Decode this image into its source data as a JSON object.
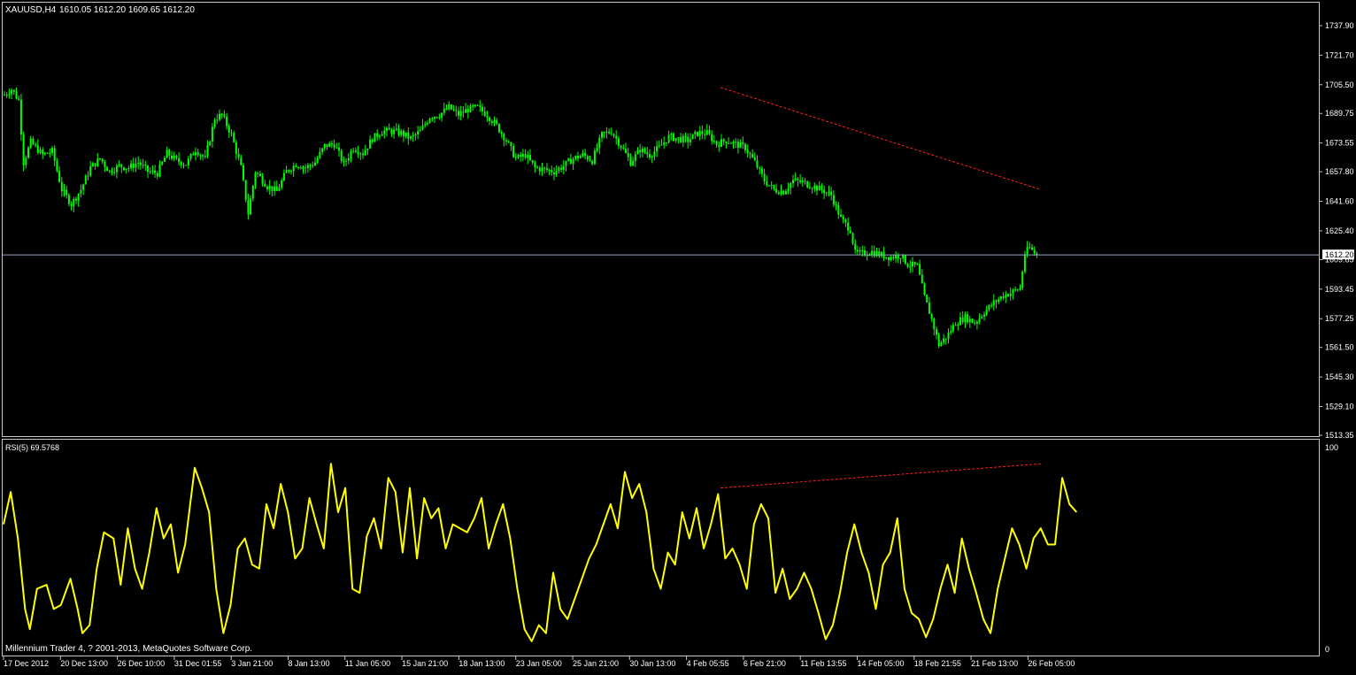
{
  "window": {
    "title": "XAUUSD,H4",
    "ohlc": "1610.05 1612.20 1609.65 1612.20"
  },
  "colors": {
    "background": "#000000",
    "frame": "#c8c8c8",
    "candle": "#00ff00",
    "rsi_line": "#ffff00",
    "trendline": "#ff2020",
    "current_price_line": "#9aa6c8"
  },
  "chart_data": [
    {
      "type": "candlestick",
      "title": "XAUUSD,H4",
      "symbol": "XAUUSD",
      "timeframe": "H4",
      "grid": false,
      "ylim": [
        1513.35,
        1750
      ],
      "y_ticks": [
        "1737.90",
        "1721.70",
        "1705.50",
        "1689.75",
        "1673.55",
        "1657.80",
        "1641.60",
        "1625.40",
        "1609.65",
        "1593.45",
        "1577.25",
        "1561.50",
        "1545.30",
        "1529.10",
        "1513.35"
      ],
      "current_price": "1612.20",
      "close_path": [
        [
          0,
          1700
        ],
        [
          3,
          1703
        ],
        [
          6,
          1697
        ],
        [
          8,
          1663
        ],
        [
          11,
          1674
        ],
        [
          16,
          1667
        ],
        [
          20,
          1669
        ],
        [
          24,
          1648
        ],
        [
          28,
          1640
        ],
        [
          32,
          1648
        ],
        [
          36,
          1660
        ],
        [
          40,
          1665
        ],
        [
          44,
          1658
        ],
        [
          48,
          1661
        ],
        [
          52,
          1660
        ],
        [
          56,
          1663
        ],
        [
          60,
          1658
        ],
        [
          64,
          1657
        ],
        [
          68,
          1668
        ],
        [
          72,
          1664
        ],
        [
          76,
          1662
        ],
        [
          80,
          1670
        ],
        [
          84,
          1665
        ],
        [
          88,
          1687
        ],
        [
          91,
          1689
        ],
        [
          95,
          1678
        ],
        [
          99,
          1660
        ],
        [
          102,
          1635
        ],
        [
          105,
          1658
        ],
        [
          110,
          1650
        ],
        [
          114,
          1647
        ],
        [
          118,
          1658
        ],
        [
          122,
          1662
        ],
        [
          126,
          1660
        ],
        [
          130,
          1663
        ],
        [
          134,
          1672
        ],
        [
          138,
          1673
        ],
        [
          142,
          1662
        ],
        [
          146,
          1671
        ],
        [
          150,
          1668
        ],
        [
          154,
          1676
        ],
        [
          158,
          1680
        ],
        [
          162,
          1680
        ],
        [
          166,
          1679
        ],
        [
          170,
          1676
        ],
        [
          174,
          1680
        ],
        [
          178,
          1688
        ],
        [
          182,
          1689
        ],
        [
          186,
          1693
        ],
        [
          190,
          1689
        ],
        [
          194,
          1692
        ],
        [
          198,
          1693
        ],
        [
          202,
          1689
        ],
        [
          206,
          1683
        ],
        [
          210,
          1675
        ],
        [
          214,
          1665
        ],
        [
          218,
          1667
        ],
        [
          222,
          1660
        ],
        [
          226,
          1659
        ],
        [
          230,
          1658
        ],
        [
          234,
          1661
        ],
        [
          238,
          1665
        ],
        [
          242,
          1667
        ],
        [
          246,
          1664
        ],
        [
          250,
          1678
        ],
        [
          254,
          1680
        ],
        [
          258,
          1672
        ],
        [
          262,
          1663
        ],
        [
          266,
          1670
        ],
        [
          270,
          1667
        ],
        [
          274,
          1671
        ],
        [
          278,
          1677
        ],
        [
          282,
          1676
        ],
        [
          286,
          1675
        ],
        [
          290,
          1679
        ],
        [
          294,
          1679
        ],
        [
          298,
          1673
        ],
        [
          302,
          1675
        ],
        [
          306,
          1673
        ],
        [
          310,
          1671
        ],
        [
          314,
          1663
        ],
        [
          318,
          1653
        ],
        [
          322,
          1648
        ],
        [
          326,
          1647
        ],
        [
          330,
          1653
        ],
        [
          334,
          1652
        ],
        [
          338,
          1650
        ],
        [
          342,
          1648
        ],
        [
          346,
          1645
        ],
        [
          350,
          1632
        ],
        [
          354,
          1626
        ],
        [
          356,
          1613
        ],
        [
          359,
          1613
        ],
        [
          363,
          1614
        ],
        [
          367,
          1612
        ],
        [
          371,
          1611
        ],
        [
          375,
          1612
        ],
        [
          378,
          1607
        ],
        [
          382,
          1606
        ],
        [
          385,
          1589
        ],
        [
          388,
          1577
        ],
        [
          391,
          1563
        ],
        [
          394,
          1567
        ],
        [
          398,
          1575
        ],
        [
          402,
          1578
        ],
        [
          406,
          1575
        ],
        [
          410,
          1581
        ],
        [
          414,
          1586
        ],
        [
          418,
          1590
        ],
        [
          422,
          1592
        ],
        [
          425,
          1594
        ],
        [
          427,
          1613
        ],
        [
          429,
          1616
        ],
        [
          432,
          1612
        ]
      ],
      "x_labels": [
        "17 Dec 2012",
        "20 Dec 13:00",
        "26 Dec 10:00",
        "31 Dec 01:55",
        "3 Jan 21:00",
        "8 Jan 13:00",
        "11 Jan 05:00",
        "15 Jan 21:00",
        "18 Jan 13:00",
        "23 Jan 05:00",
        "25 Jan 21:00",
        "30 Jan 13:00",
        "4 Feb 05:55",
        "6 Feb 21:00",
        "11 Feb 13:55",
        "14 Feb 05:00",
        "18 Feb 21:55",
        "21 Feb 13:00",
        "26 Feb 05:00"
      ],
      "annotations": [
        {
          "type": "trendline",
          "color": "#ff2020",
          "style": "dashed",
          "from": {
            "bar": 300,
            "price": 1704
          },
          "to": {
            "bar": 434,
            "price": 1648
          }
        }
      ]
    },
    {
      "type": "line",
      "title": "RSI(5) 69.5768",
      "series": [
        {
          "name": "RSI(5)",
          "value": "69.5768"
        }
      ],
      "ylim": [
        0,
        100
      ],
      "y_ticks": [
        "100",
        "0"
      ],
      "values": [
        [
          0,
          62
        ],
        [
          3,
          78
        ],
        [
          6,
          55
        ],
        [
          9,
          20
        ],
        [
          11,
          10
        ],
        [
          14,
          30
        ],
        [
          18,
          32
        ],
        [
          21,
          20
        ],
        [
          24,
          22
        ],
        [
          28,
          35
        ],
        [
          31,
          20
        ],
        [
          33,
          8
        ],
        [
          36,
          12
        ],
        [
          39,
          40
        ],
        [
          42,
          58
        ],
        [
          46,
          55
        ],
        [
          49,
          32
        ],
        [
          52,
          60
        ],
        [
          55,
          40
        ],
        [
          58,
          30
        ],
        [
          61,
          48
        ],
        [
          64,
          70
        ],
        [
          67,
          55
        ],
        [
          70,
          62
        ],
        [
          73,
          38
        ],
        [
          76,
          52
        ],
        [
          80,
          90
        ],
        [
          83,
          80
        ],
        [
          86,
          68
        ],
        [
          89,
          30
        ],
        [
          92,
          8
        ],
        [
          95,
          22
        ],
        [
          98,
          50
        ],
        [
          101,
          55
        ],
        [
          104,
          42
        ],
        [
          107,
          40
        ],
        [
          110,
          72
        ],
        [
          113,
          60
        ],
        [
          116,
          82
        ],
        [
          119,
          68
        ],
        [
          122,
          45
        ],
        [
          125,
          50
        ],
        [
          128,
          75
        ],
        [
          131,
          62
        ],
        [
          134,
          50
        ],
        [
          137,
          92
        ],
        [
          140,
          68
        ],
        [
          143,
          80
        ],
        [
          146,
          30
        ],
        [
          149,
          28
        ],
        [
          152,
          56
        ],
        [
          155,
          65
        ],
        [
          158,
          50
        ],
        [
          161,
          85
        ],
        [
          164,
          78
        ],
        [
          167,
          48
        ],
        [
          170,
          80
        ],
        [
          173,
          45
        ],
        [
          176,
          75
        ],
        [
          179,
          65
        ],
        [
          182,
          70
        ],
        [
          185,
          50
        ],
        [
          188,
          62
        ],
        [
          191,
          60
        ],
        [
          194,
          58
        ],
        [
          197,
          65
        ],
        [
          200,
          75
        ],
        [
          203,
          50
        ],
        [
          206,
          62
        ],
        [
          209,
          72
        ],
        [
          212,
          55
        ],
        [
          215,
          30
        ],
        [
          218,
          10
        ],
        [
          221,
          4
        ],
        [
          224,
          12
        ],
        [
          227,
          8
        ],
        [
          230,
          38
        ],
        [
          233,
          20
        ],
        [
          236,
          15
        ],
        [
          239,
          25
        ],
        [
          242,
          35
        ],
        [
          245,
          45
        ],
        [
          248,
          52
        ],
        [
          251,
          62
        ],
        [
          254,
          72
        ],
        [
          257,
          60
        ],
        [
          260,
          88
        ],
        [
          263,
          75
        ],
        [
          266,
          82
        ],
        [
          269,
          68
        ],
        [
          272,
          40
        ],
        [
          275,
          30
        ],
        [
          278,
          48
        ],
        [
          281,
          42
        ],
        [
          284,
          68
        ],
        [
          287,
          55
        ],
        [
          290,
          70
        ],
        [
          293,
          50
        ],
        [
          296,
          62
        ],
        [
          299,
          77
        ],
        [
          302,
          45
        ],
        [
          305,
          50
        ],
        [
          308,
          42
        ],
        [
          311,
          30
        ],
        [
          314,
          62
        ],
        [
          317,
          72
        ],
        [
          320,
          65
        ],
        [
          323,
          28
        ],
        [
          326,
          40
        ],
        [
          329,
          25
        ],
        [
          332,
          30
        ],
        [
          335,
          38
        ],
        [
          338,
          30
        ],
        [
          341,
          18
        ],
        [
          344,
          5
        ],
        [
          347,
          12
        ],
        [
          350,
          28
        ],
        [
          353,
          48
        ],
        [
          356,
          62
        ],
        [
          359,
          48
        ],
        [
          362,
          38
        ],
        [
          365,
          20
        ],
        [
          368,
          42
        ],
        [
          371,
          48
        ],
        [
          374,
          65
        ],
        [
          377,
          30
        ],
        [
          380,
          18
        ],
        [
          383,
          15
        ],
        [
          386,
          6
        ],
        [
          389,
          15
        ],
        [
          392,
          30
        ],
        [
          395,
          42
        ],
        [
          398,
          28
        ],
        [
          401,
          55
        ],
        [
          404,
          40
        ],
        [
          407,
          28
        ],
        [
          410,
          15
        ],
        [
          413,
          8
        ],
        [
          416,
          30
        ],
        [
          419,
          45
        ],
        [
          422,
          60
        ],
        [
          425,
          52
        ],
        [
          428,
          40
        ],
        [
          431,
          55
        ],
        [
          434,
          60
        ],
        [
          437,
          52
        ],
        [
          440,
          52
        ],
        [
          443,
          85
        ],
        [
          446,
          72
        ],
        [
          449,
          68
        ]
      ],
      "annotations": [
        {
          "type": "trendline",
          "color": "#ff2020",
          "style": "dashed",
          "from": {
            "bar": 300,
            "rsi": 80
          },
          "to": {
            "bar": 434,
            "rsi": 92
          }
        }
      ]
    }
  ],
  "footer": {
    "copyright": "Millennium Trader 4, ? 2001-2013, MetaQuotes Software Corp."
  }
}
